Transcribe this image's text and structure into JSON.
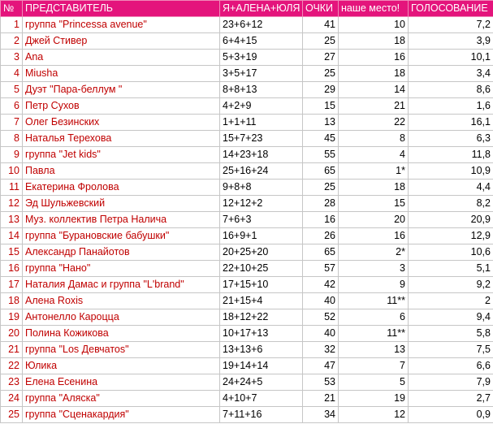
{
  "colors": {
    "header_bg": "#e4147c",
    "header_text": "#ffffff",
    "accent_text": "#c00000",
    "grid": "#c6c6c6"
  },
  "headers": {
    "num": "№",
    "name": "ПРЕДСТАВИТЕЛЬ",
    "votes": "Я+АЛЕНА+ЮЛЯ",
    "points": "ОЧКИ",
    "place": "наше место!",
    "vote": "ГОЛОСОВАНИЕ"
  },
  "rows": [
    {
      "num": "1",
      "name": "группа \"Princessa avenue\"",
      "votes": "23+6+12",
      "points": "41",
      "place": "10",
      "vote": "7,2"
    },
    {
      "num": "2",
      "name": "Джей Стивер",
      "votes": "6+4+15",
      "points": "25",
      "place": "18",
      "vote": "3,9"
    },
    {
      "num": "3",
      "name": "Ana",
      "votes": "5+3+19",
      "points": "27",
      "place": "16",
      "vote": "10,1"
    },
    {
      "num": "4",
      "name": "Miusha",
      "votes": "3+5+17",
      "points": "25",
      "place": "18",
      "vote": "3,4"
    },
    {
      "num": "5",
      "name": "Дуэт \"Пара-беллум \"",
      "votes": "8+8+13",
      "points": "29",
      "place": "14",
      "vote": "8,6"
    },
    {
      "num": "6",
      "name": "Петр Сухов",
      "votes": "4+2+9",
      "points": "15",
      "place": "21",
      "vote": "1,6"
    },
    {
      "num": "7",
      "name": "Олег Безинских",
      "votes": "1+1+11",
      "points": "13",
      "place": "22",
      "vote": "16,1"
    },
    {
      "num": "8",
      "name": "Наталья Терехова",
      "votes": "15+7+23",
      "points": "45",
      "place": "8",
      "vote": "6,3"
    },
    {
      "num": "9",
      "name": "группа \"Jet kids\"",
      "votes": "14+23+18",
      "points": "55",
      "place": "4",
      "vote": "11,8"
    },
    {
      "num": "10",
      "name": "Павла",
      "votes": "25+16+24",
      "points": "65",
      "place": "1*",
      "vote": "10,9"
    },
    {
      "num": "11",
      "name": "Екатерина Фролова",
      "votes": "9+8+8",
      "points": "25",
      "place": "18",
      "vote": "4,4"
    },
    {
      "num": "12",
      "name": "Эд Шульжевский",
      "votes": "12+12+2",
      "points": "28",
      "place": "15",
      "vote": "8,2"
    },
    {
      "num": "13",
      "name": "Муз. коллектив Петра Налича",
      "votes": "7+6+3",
      "points": "16",
      "place": "20",
      "vote": "20,9"
    },
    {
      "num": "14",
      "name": "группа \"Бурановские бабушки\"",
      "votes": "16+9+1",
      "points": "26",
      "place": "16",
      "vote": "12,9"
    },
    {
      "num": "15",
      "name": "Александр Панайотов",
      "votes": "20+25+20",
      "points": "65",
      "place": "2*",
      "vote": "10,6"
    },
    {
      "num": "16",
      "name": "группа \"Нано\"",
      "votes": "22+10+25",
      "points": "57",
      "place": "3",
      "vote": "5,1"
    },
    {
      "num": "17",
      "name": "Наталия Дамас и группа \"L'brand\"",
      "votes": "17+15+10",
      "points": "42",
      "place": "9",
      "vote": "9,2"
    },
    {
      "num": "18",
      "name": " Алена Roxis",
      "votes": "21+15+4",
      "points": "40",
      "place": "11**",
      "vote": "2"
    },
    {
      "num": "19",
      "name": "Антонелло Кароцца",
      "votes": "18+12+22",
      "points": "52",
      "place": "6",
      "vote": "9,4"
    },
    {
      "num": "20",
      "name": "Полина Кожикова",
      "votes": "10+17+13",
      "points": "40",
      "place": "11**",
      "vote": "5,8"
    },
    {
      "num": "21",
      "name": "группа \"Los Девчатоs\"",
      "votes": "13+13+6",
      "points": "32",
      "place": "13",
      "vote": "7,5"
    },
    {
      "num": "22",
      "name": "Юлика",
      "votes": "19+14+14",
      "points": "47",
      "place": "7",
      "vote": "6,6"
    },
    {
      "num": "23",
      "name": "Елена Есенина",
      "votes": "24+24+5",
      "points": "53",
      "place": "5",
      "vote": "7,9"
    },
    {
      "num": "24",
      "name": "группа \"Аляска\"",
      "votes": "4+10+7",
      "points": "21",
      "place": "19",
      "vote": "2,7"
    },
    {
      "num": "25",
      "name": "группа \"Сценакардия\"",
      "votes": "7+11+16",
      "points": "34",
      "place": "12",
      "vote": "0,9"
    }
  ]
}
